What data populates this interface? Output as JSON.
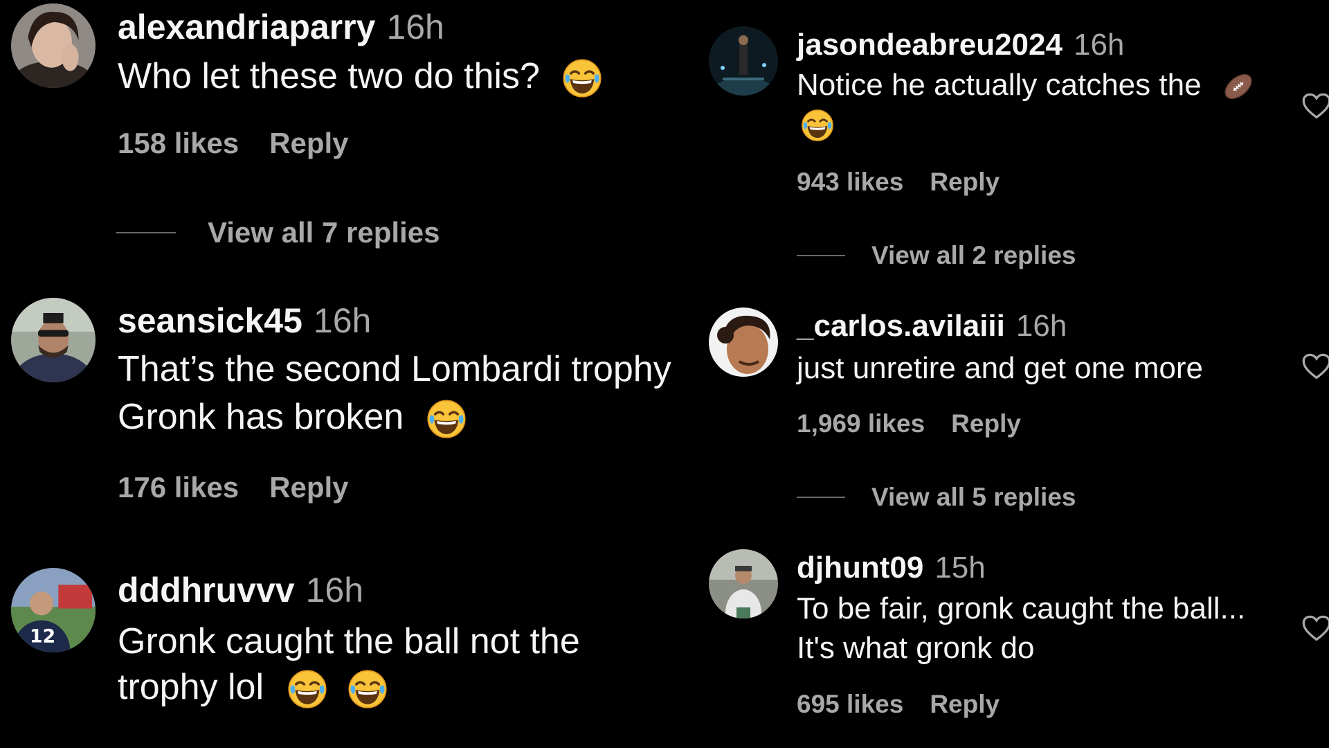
{
  "comments_left": [
    {
      "username": "alexandriaparry",
      "time": "16h",
      "lines": [
        "Who let these two do this?"
      ],
      "emoji_count": 1,
      "likes": "158 likes",
      "reply_label": "Reply",
      "view_replies": "View all 7 replies"
    },
    {
      "username": "seansick45",
      "time": "16h",
      "lines": [
        "That’s the second Lombardi trophy",
        "Gronk has broken"
      ],
      "emoji_count": 1,
      "likes": "176 likes",
      "reply_label": "Reply"
    },
    {
      "username": "dddhruvvv",
      "time": "16h",
      "lines": [
        "Gronk caught the ball not the",
        "trophy lol"
      ],
      "emoji_count": 2
    }
  ],
  "comments_right": [
    {
      "username": "jasondeabreu2024",
      "time": "16h",
      "lines": [
        "Notice he actually catches the"
      ],
      "emoji": [
        "football-emoji",
        "laughing-emoji"
      ],
      "likes": "943 likes",
      "reply_label": "Reply",
      "view_replies": "View all 2 replies"
    },
    {
      "username": "_carlos.avilaiii",
      "time": "16h",
      "lines": [
        "just unretire and get one more"
      ],
      "likes": "1,969 likes",
      "reply_label": "Reply",
      "view_replies": "View all 5 replies"
    },
    {
      "username": "djhunt09",
      "time": "15h",
      "lines": [
        "To be fair, gronk caught the ball...",
        "It's what gronk do"
      ],
      "likes": "695 likes",
      "reply_label": "Reply"
    }
  ],
  "icons": {
    "like": "heart-outline-icon",
    "laugh": "face-with-tears-of-joy-emoji",
    "football": "american-football-emoji"
  },
  "colors": {
    "background": "#000000",
    "primary_text": "#f5f5f5",
    "secondary_text": "#a8a8a8",
    "emoji_yellow": "#f9c43a"
  }
}
